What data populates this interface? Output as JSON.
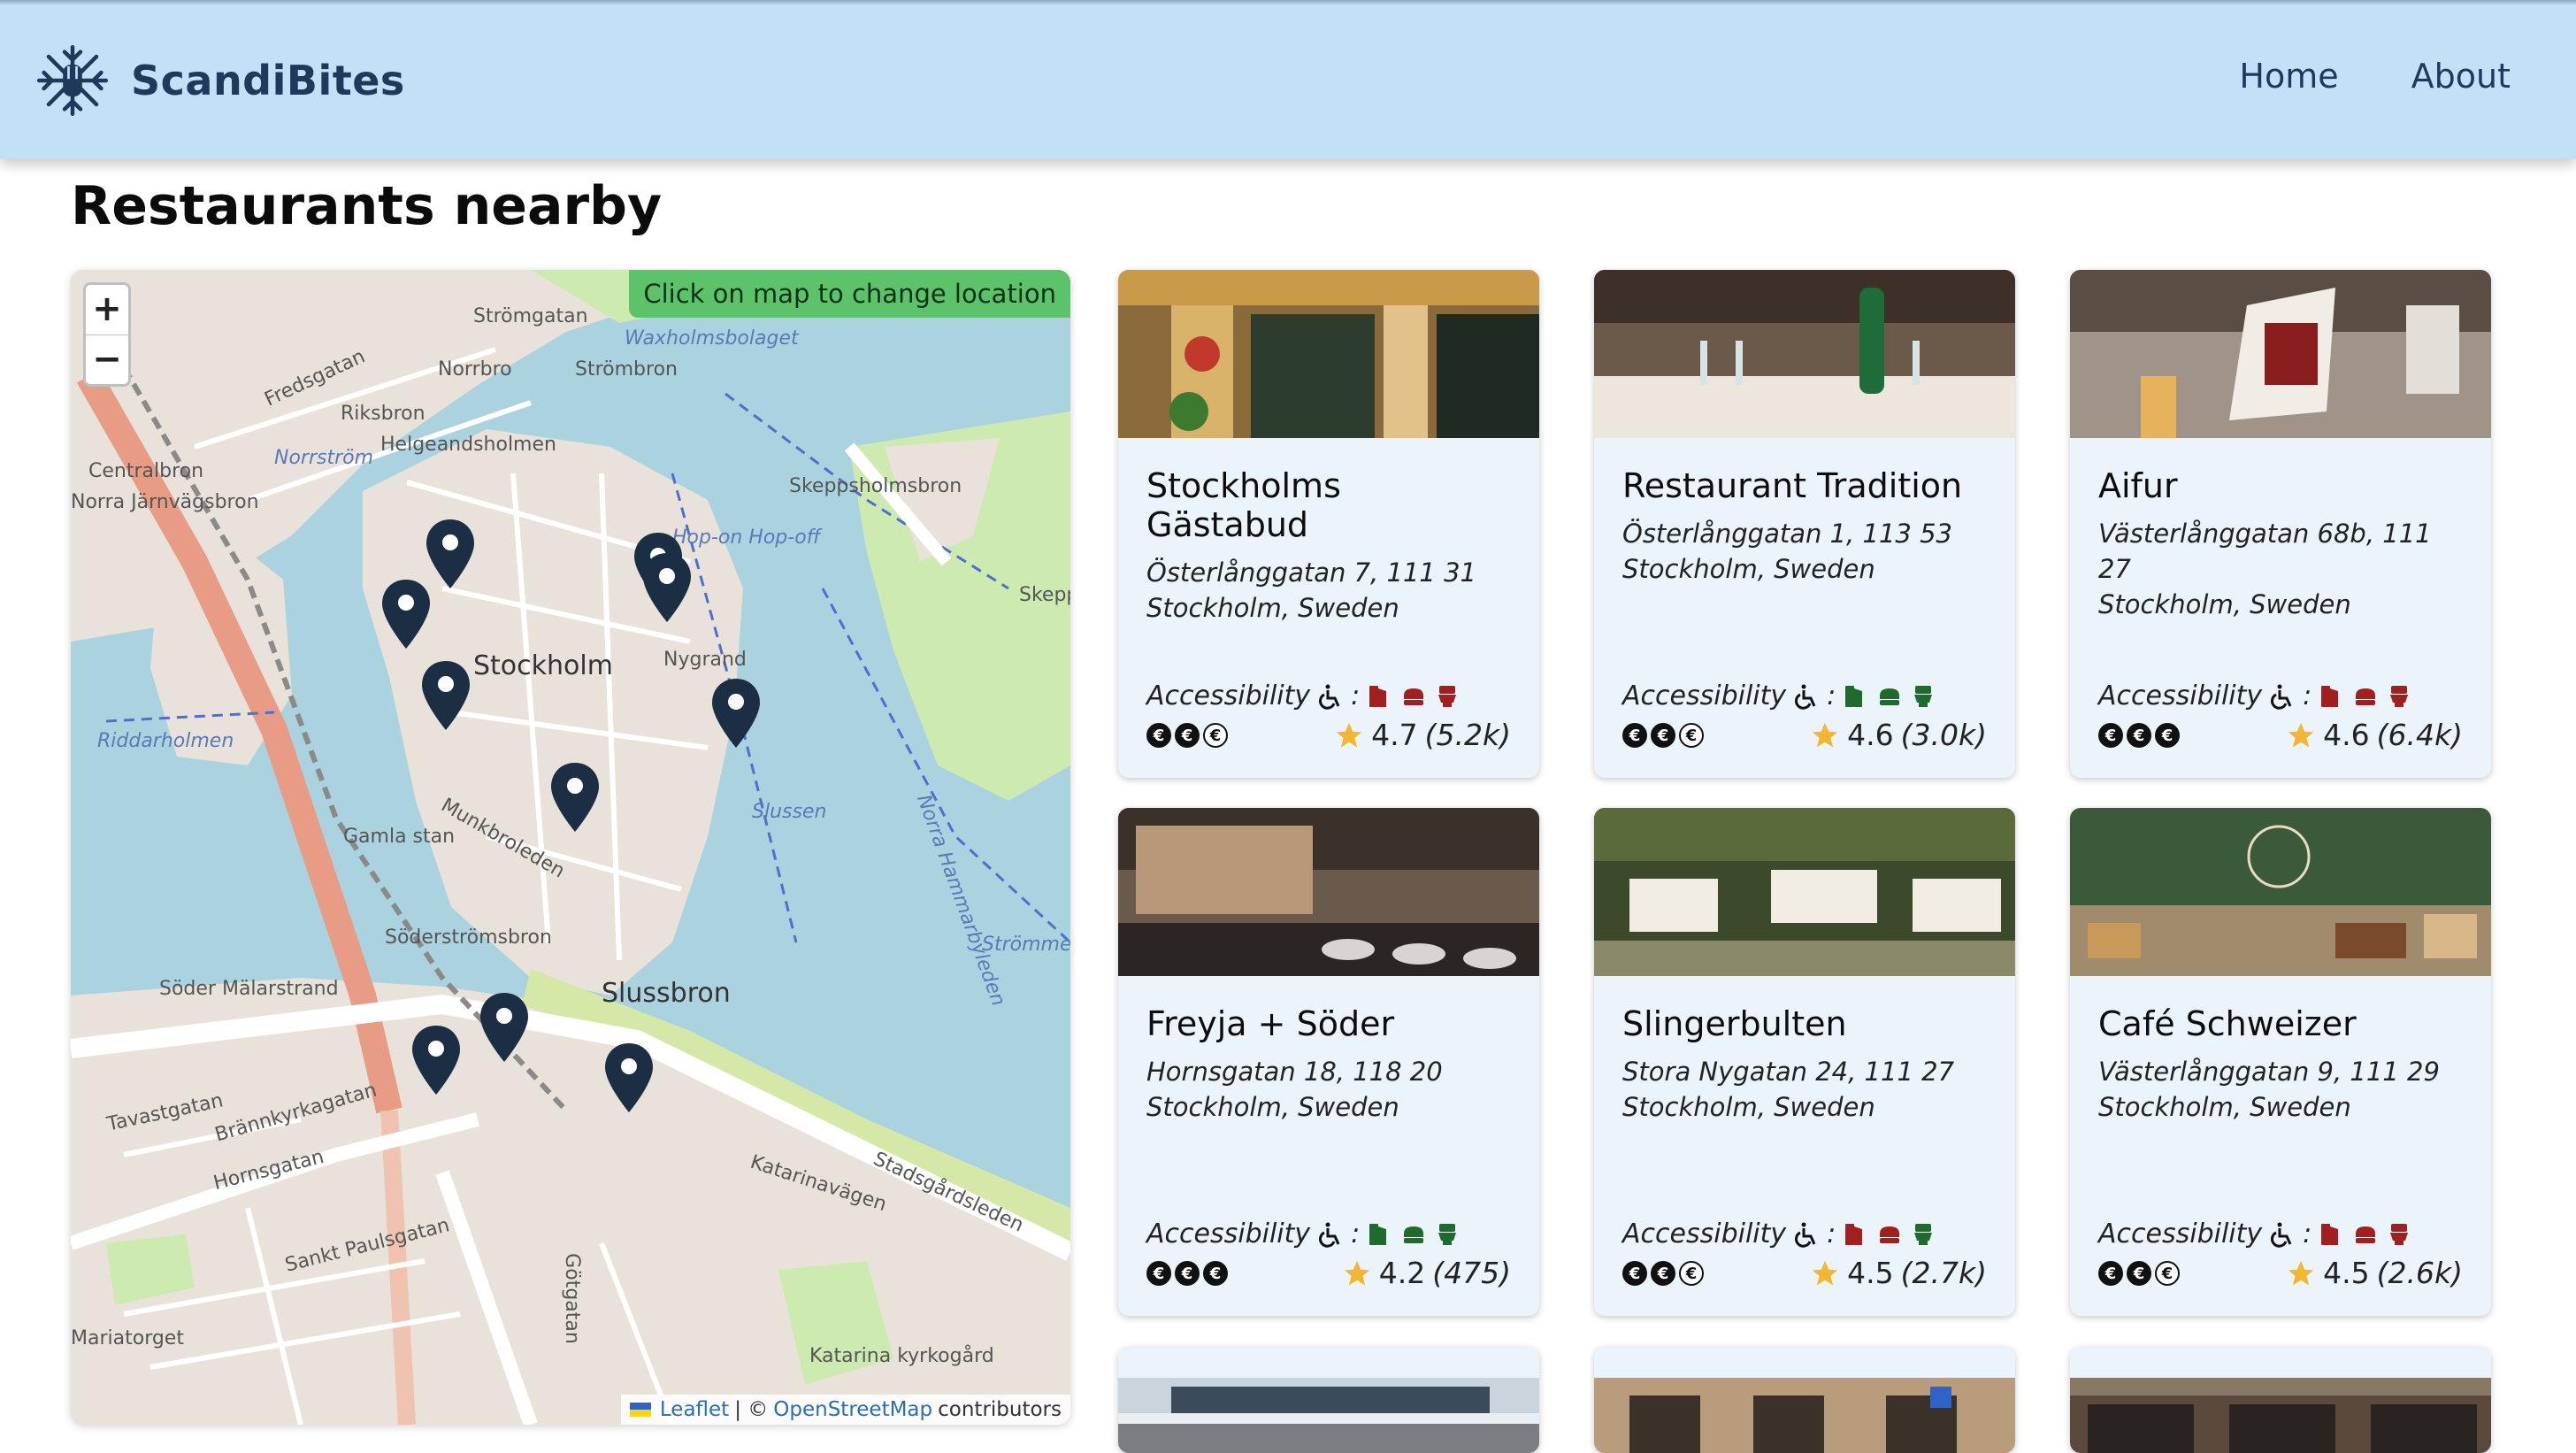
{
  "header": {
    "brand": "ScandiBites",
    "nav": [
      {
        "label": "Home"
      },
      {
        "label": "About"
      }
    ]
  },
  "page_title": "Restaurants nearby",
  "map": {
    "hint": "Click on map to change location",
    "zoom_in": "+",
    "zoom_out": "−",
    "attribution": {
      "leaflet": "Leaflet",
      "sep": "| ©",
      "osm": "OpenStreetMap",
      "tail": "contributors"
    },
    "labels": [
      "Strömgatan",
      "Norrbro",
      "Strömbron",
      "Waxholmsbolaget",
      "Riksbron",
      "Helgeandsholmen",
      "Norrström",
      "Centralbron",
      "Norra Järnvägsbron",
      "Skeppsholmsbron",
      "Stockholm",
      "Riddarholmen",
      "Nygrand",
      "Slussen",
      "Gamla stan",
      "Söderströmsbron",
      "Söder Mälarstrand",
      "Slussbron",
      "Stadsgårdsleden",
      "Katarinavägen",
      "Hornsgatan",
      "Sankt Paulsgatan",
      "Mariatorget",
      "Katarina kyrkogård",
      "Strömmen",
      "Skepp",
      "Munkbroleden",
      "Fredsgatan",
      "Hop-on Hop-off",
      "Norra Hammarbyleden",
      "Brännkyrkagatan",
      "Tavastgatan",
      "Götgatan"
    ]
  },
  "accessibility_label": "Accessibility",
  "colors": {
    "acc_yes": "#1f6b2e",
    "acc_no": "#a11f1f",
    "header_bg": "#c2e1f7",
    "card_bg": "#ebf4fb"
  },
  "restaurants": [
    {
      "name": "Stockholms Gästabud",
      "addr1": "Österlånggatan 7, 111 31",
      "addr2": "Stockholm, Sweden",
      "access": {
        "entrance": false,
        "seating": false,
        "toilet": false
      },
      "price_level": 2,
      "rating": "4.7",
      "reviews": "(5.2k)"
    },
    {
      "name": "Restaurant Tradition",
      "addr1": "Österlånggatan 1, 113 53",
      "addr2": "Stockholm, Sweden",
      "access": {
        "entrance": true,
        "seating": true,
        "toilet": true
      },
      "price_level": 2,
      "rating": "4.6",
      "reviews": "(3.0k)"
    },
    {
      "name": "Aifur",
      "addr1": "Västerlånggatan 68b, 111 27",
      "addr2": "Stockholm, Sweden",
      "access": {
        "entrance": false,
        "seating": false,
        "toilet": false
      },
      "price_level": 3,
      "rating": "4.6",
      "reviews": "(6.4k)"
    },
    {
      "name": "Freyja + Söder",
      "addr1": "Hornsgatan 18, 118 20",
      "addr2": "Stockholm, Sweden",
      "access": {
        "entrance": true,
        "seating": true,
        "toilet": true
      },
      "price_level": 3,
      "rating": "4.2",
      "reviews": "(475)"
    },
    {
      "name": "Slingerbulten",
      "addr1": "Stora Nygatan 24, 111 27",
      "addr2": "Stockholm, Sweden",
      "access": {
        "entrance": false,
        "seating": false,
        "toilet": true
      },
      "price_level": 2,
      "rating": "4.5",
      "reviews": "(2.7k)"
    },
    {
      "name": "Café Schweizer",
      "addr1": "Västerlånggatan 9, 111 29",
      "addr2": "Stockholm, Sweden",
      "access": {
        "entrance": false,
        "seating": false,
        "toilet": false
      },
      "price_level": 2,
      "rating": "4.5",
      "reviews": "(2.6k)"
    }
  ]
}
